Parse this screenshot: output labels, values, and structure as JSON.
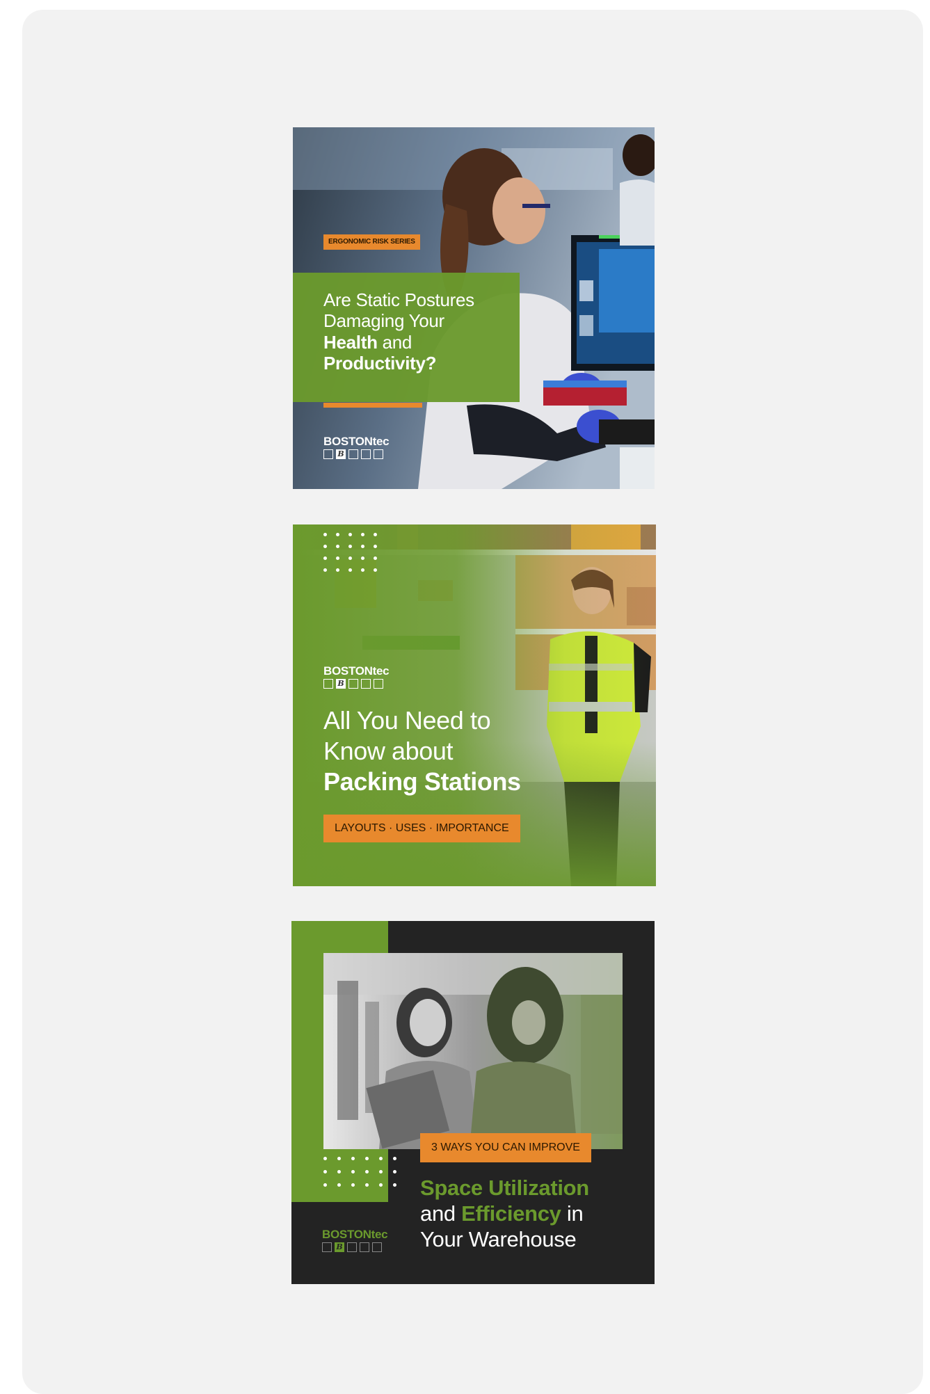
{
  "cards": [
    {
      "tag": "ERGONOMIC RISK SERIES",
      "title_line1": "Are Static Postures",
      "title_line2": "Damaging Your",
      "title_bold3": "Health",
      "title_rest3": " and",
      "title_bold4": "Productivity?",
      "logo": "BOSTONtec"
    },
    {
      "logo": "BOSTONtec",
      "title_line1": "All You Need to",
      "title_line2": "Know about",
      "title_bold3": "Packing Stations",
      "tag": "LAYOUTS · USES · IMPORTANCE"
    },
    {
      "tag": "3 WAYS YOU CAN IMPROVE",
      "title_green1": "Space Utilization",
      "title_plain2a": "and ",
      "title_green2": "Efficiency",
      "title_plain2b": " in",
      "title_line3": "Your Warehouse",
      "logo": "BOSTONtec"
    }
  ],
  "logo_mark": "B",
  "colors": {
    "green": "#6b9a2d",
    "orange": "#e8892d",
    "dark": "#232323",
    "panel": "#f2f2f2"
  }
}
